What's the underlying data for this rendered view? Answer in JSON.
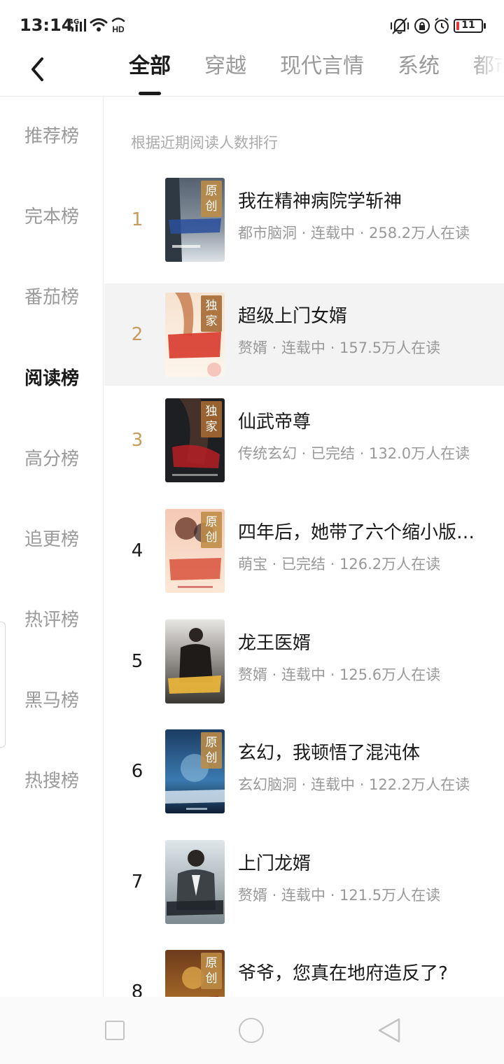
{
  "status_bar": {
    "time": "13:14",
    "network": "4G",
    "battery": "11",
    "battery_level": 0.11,
    "battery_color": "#e53935",
    "icons": [
      "signal-icon",
      "wifi-icon",
      "hd-icon",
      "vibrate-icon",
      "rotation-lock-icon",
      "alarm-icon",
      "battery-icon"
    ]
  },
  "header": {
    "back_icon": "chevron-left-icon",
    "tabs": [
      {
        "label": "全部",
        "active": true
      },
      {
        "label": "穿越",
        "active": false
      },
      {
        "label": "现代言情",
        "active": false
      },
      {
        "label": "系统",
        "active": false
      },
      {
        "label": "都市",
        "active": false
      }
    ]
  },
  "sidebar": {
    "items": [
      {
        "label": "推荐榜",
        "active": false
      },
      {
        "label": "完本榜",
        "active": false
      },
      {
        "label": "番茄榜",
        "active": false
      },
      {
        "label": "阅读榜",
        "active": true
      },
      {
        "label": "高分榜",
        "active": false
      },
      {
        "label": "追更榜",
        "active": false
      },
      {
        "label": "热评榜",
        "active": false
      },
      {
        "label": "黑马榜",
        "active": false
      },
      {
        "label": "热搜榜",
        "active": false
      }
    ]
  },
  "list": {
    "hint": "根据近期阅读人数排行",
    "rank_top_color": "#c89b5e",
    "books": [
      {
        "rank": "1",
        "title": "我在精神病院学斩神",
        "meta": "都市脑洞 · 连载中 · 258.2万人在读",
        "tag": "原创"
      },
      {
        "rank": "2",
        "title": "超级上门女婿",
        "meta": "赘婿 · 连载中 · 157.5万人在读",
        "tag": "独家"
      },
      {
        "rank": "3",
        "title": "仙武帝尊",
        "meta": "传统玄幻 · 已完结 · 132.0万人在读",
        "tag": "独家"
      },
      {
        "rank": "4",
        "title": "四年后，她带了六个缩小版大佬回归",
        "meta": "萌宝 · 已完结 · 126.2万人在读",
        "tag": "原创"
      },
      {
        "rank": "5",
        "title": "龙王医婿",
        "meta": "赘婿 · 连载中 · 125.6万人在读",
        "tag": ""
      },
      {
        "rank": "6",
        "title": "玄幻，我顿悟了混沌体",
        "meta": "玄幻脑洞 · 连载中 · 122.2万人在读",
        "tag": "原创"
      },
      {
        "rank": "7",
        "title": "上门龙婿",
        "meta": "赘婿 · 连载中 · 121.5万人在读",
        "tag": ""
      },
      {
        "rank": "8",
        "title": "爷爷，您真在地府造反了?",
        "meta": "",
        "tag": "原创"
      }
    ]
  },
  "nav_bar": {
    "icons": [
      "recent-apps-icon",
      "home-icon",
      "back-icon"
    ]
  }
}
